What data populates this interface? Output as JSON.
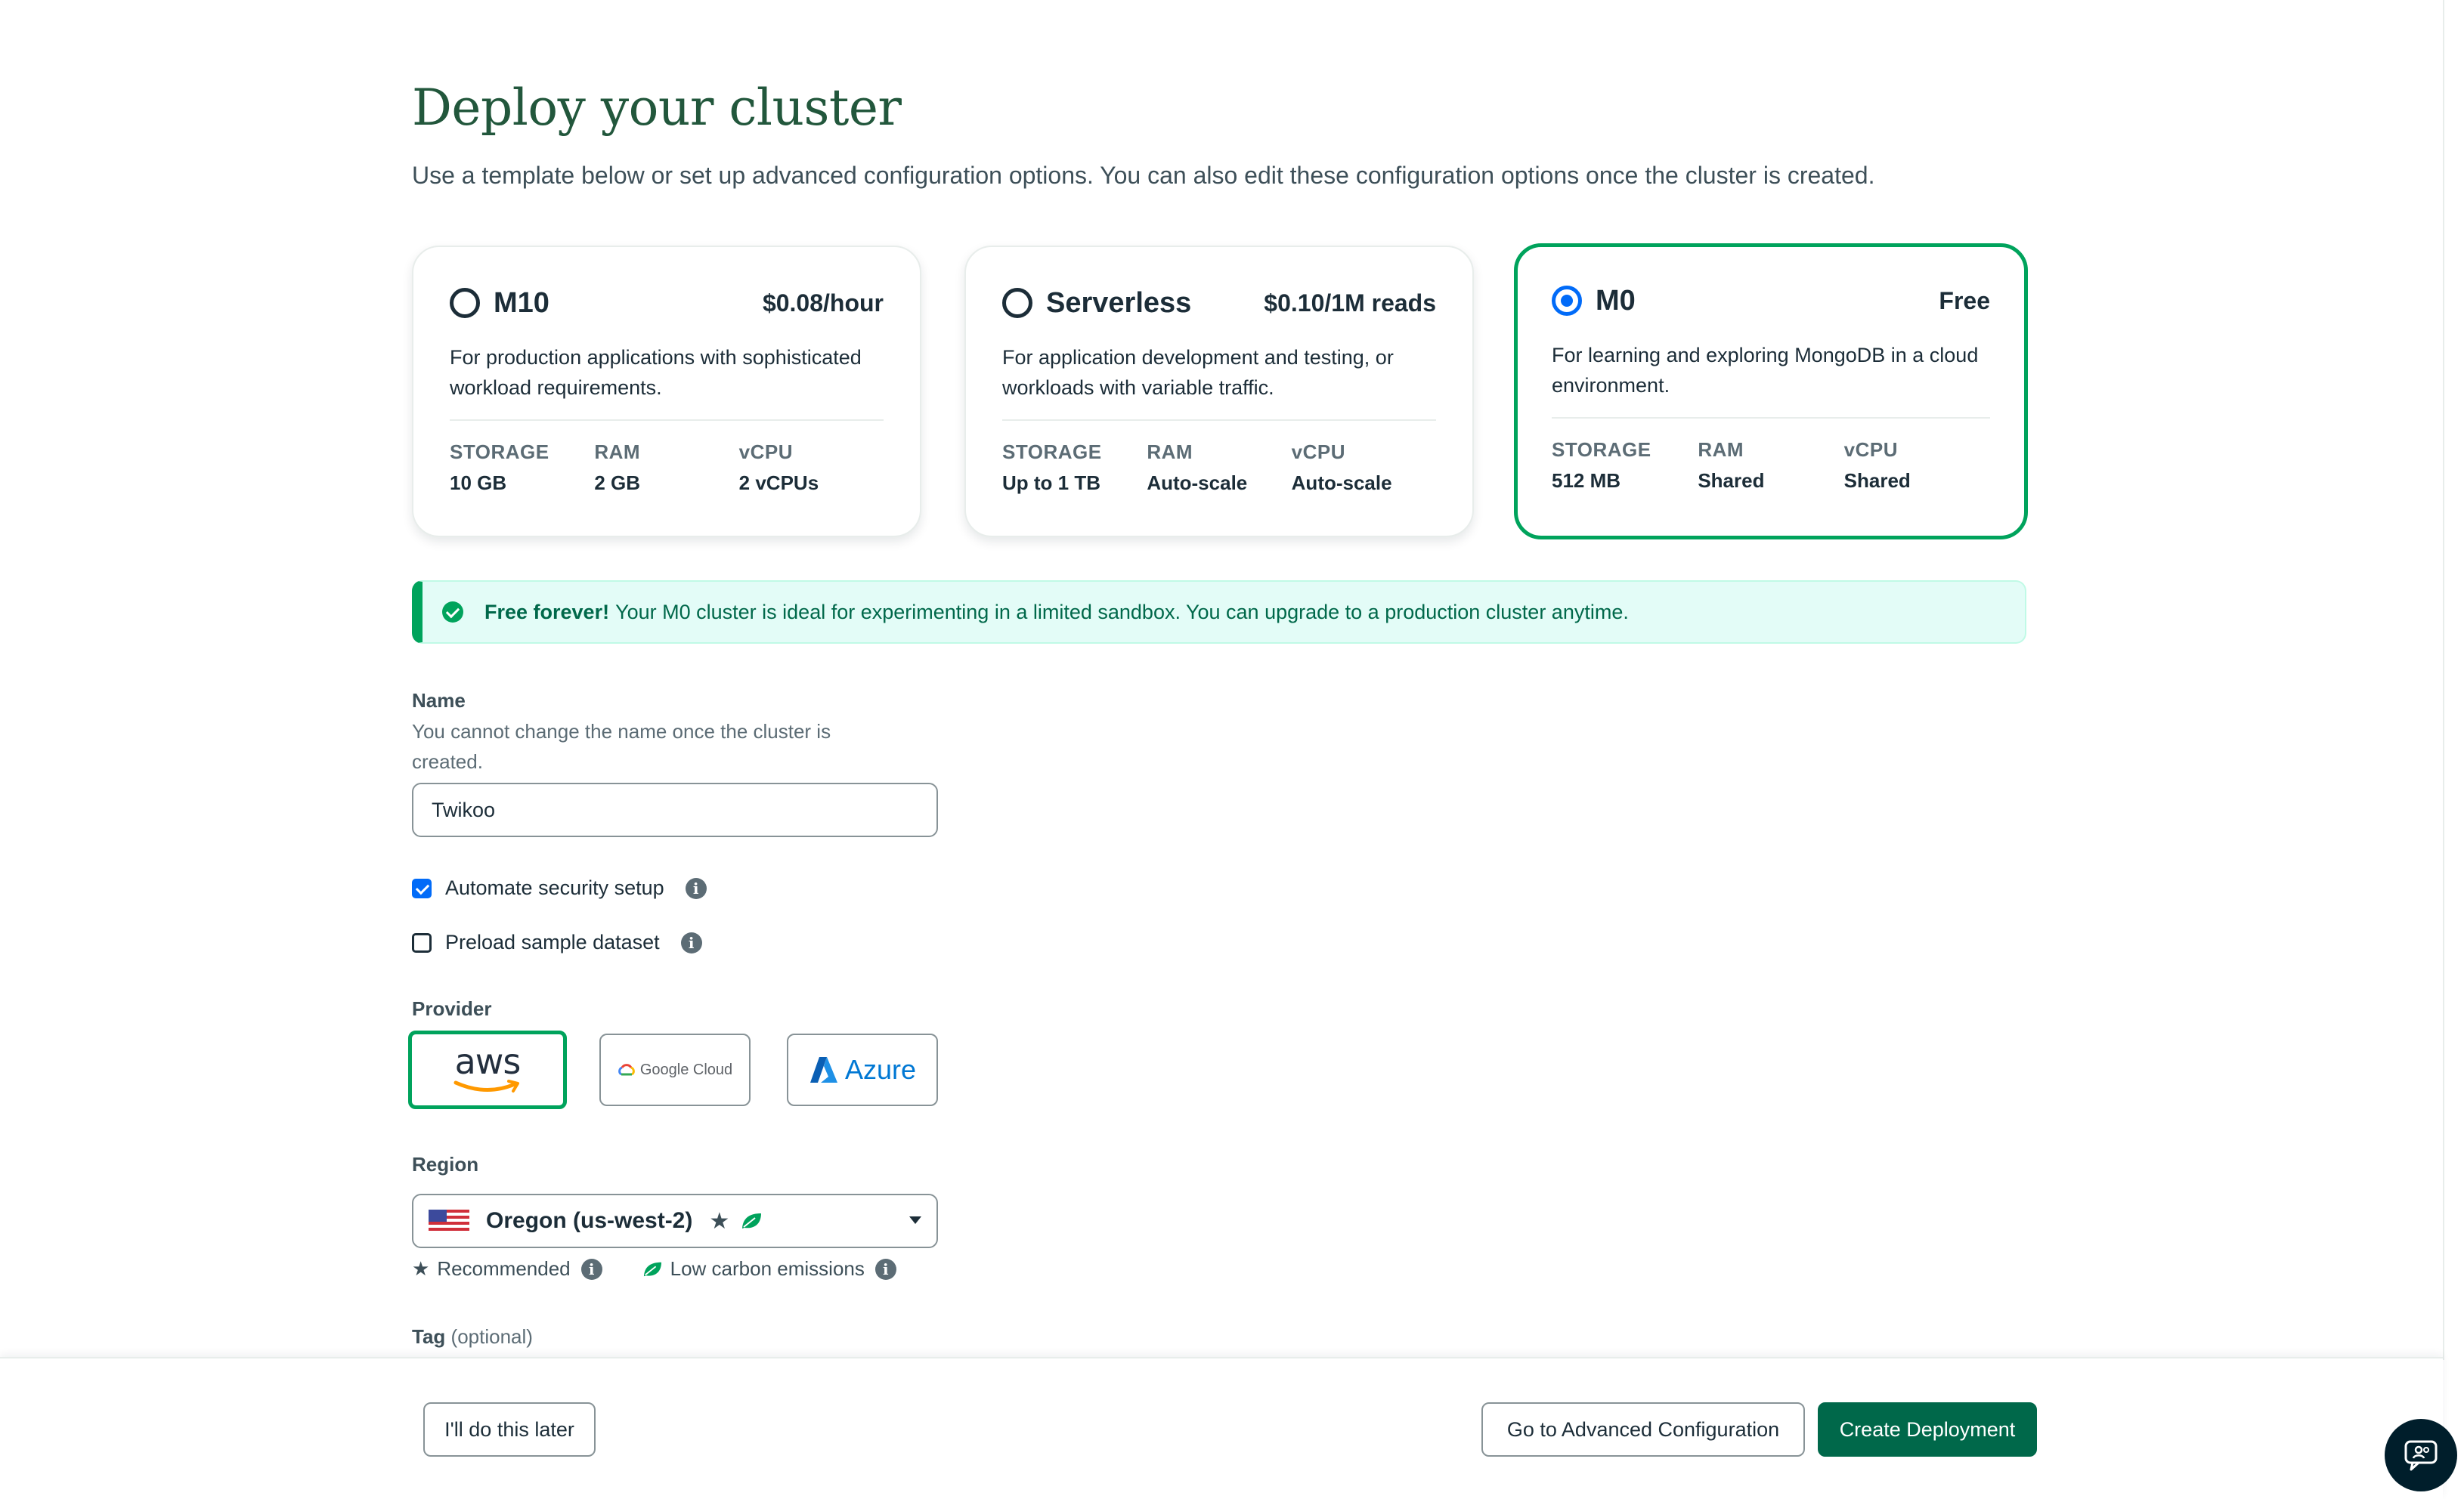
{
  "page": {
    "title": "Deploy your cluster",
    "subtitle": "Use a template below or set up advanced configuration options. You can also edit these configuration options once the cluster is created."
  },
  "tiers": [
    {
      "name": "M10",
      "price": "$0.08/hour",
      "description": "For production applications with sophisticated workload requirements.",
      "selected": false,
      "specs": [
        {
          "label": "STORAGE",
          "value": "10 GB"
        },
        {
          "label": "RAM",
          "value": "2 GB"
        },
        {
          "label": "vCPU",
          "value": "2 vCPUs"
        }
      ]
    },
    {
      "name": "Serverless",
      "price": "$0.10/1M reads",
      "description": "For application development and testing, or workloads with variable traffic.",
      "selected": false,
      "specs": [
        {
          "label": "STORAGE",
          "value": "Up to 1 TB"
        },
        {
          "label": "RAM",
          "value": "Auto-scale"
        },
        {
          "label": "vCPU",
          "value": "Auto-scale"
        }
      ]
    },
    {
      "name": "M0",
      "price": "Free",
      "description": "For learning and exploring MongoDB in a cloud environment.",
      "selected": true,
      "specs": [
        {
          "label": "STORAGE",
          "value": "512 MB"
        },
        {
          "label": "RAM",
          "value": "Shared"
        },
        {
          "label": "vCPU",
          "value": "Shared"
        }
      ]
    }
  ],
  "banner": {
    "strong": "Free forever!",
    "text": "Your M0 cluster is ideal for experimenting in a limited sandbox. You can upgrade to a production cluster anytime."
  },
  "name_field": {
    "label": "Name",
    "help": "You cannot change the name once the cluster is created.",
    "value": "Twikoo"
  },
  "options": {
    "automate_security": {
      "label": "Automate security setup",
      "checked": true
    },
    "preload_sample": {
      "label": "Preload sample dataset",
      "checked": false
    }
  },
  "provider": {
    "label": "Provider",
    "aws": "aws",
    "google": "Google Cloud",
    "azure": "Azure",
    "selected": "aws"
  },
  "region": {
    "label": "Region",
    "value": "Oregon (us-west-2)",
    "legend_recommended": "Recommended",
    "legend_low_carbon": "Low carbon emissions"
  },
  "tag": {
    "label": "Tag",
    "optional": "(optional)"
  },
  "footer": {
    "later": "I'll do this later",
    "advanced": "Go to Advanced Configuration",
    "create": "Create Deployment"
  },
  "colors": {
    "brand_green": "#00684a",
    "selected_border": "#00a35c",
    "title_green": "#22573c",
    "radio_blue": "#016bf8",
    "banner_bg": "#e3fcf7"
  }
}
